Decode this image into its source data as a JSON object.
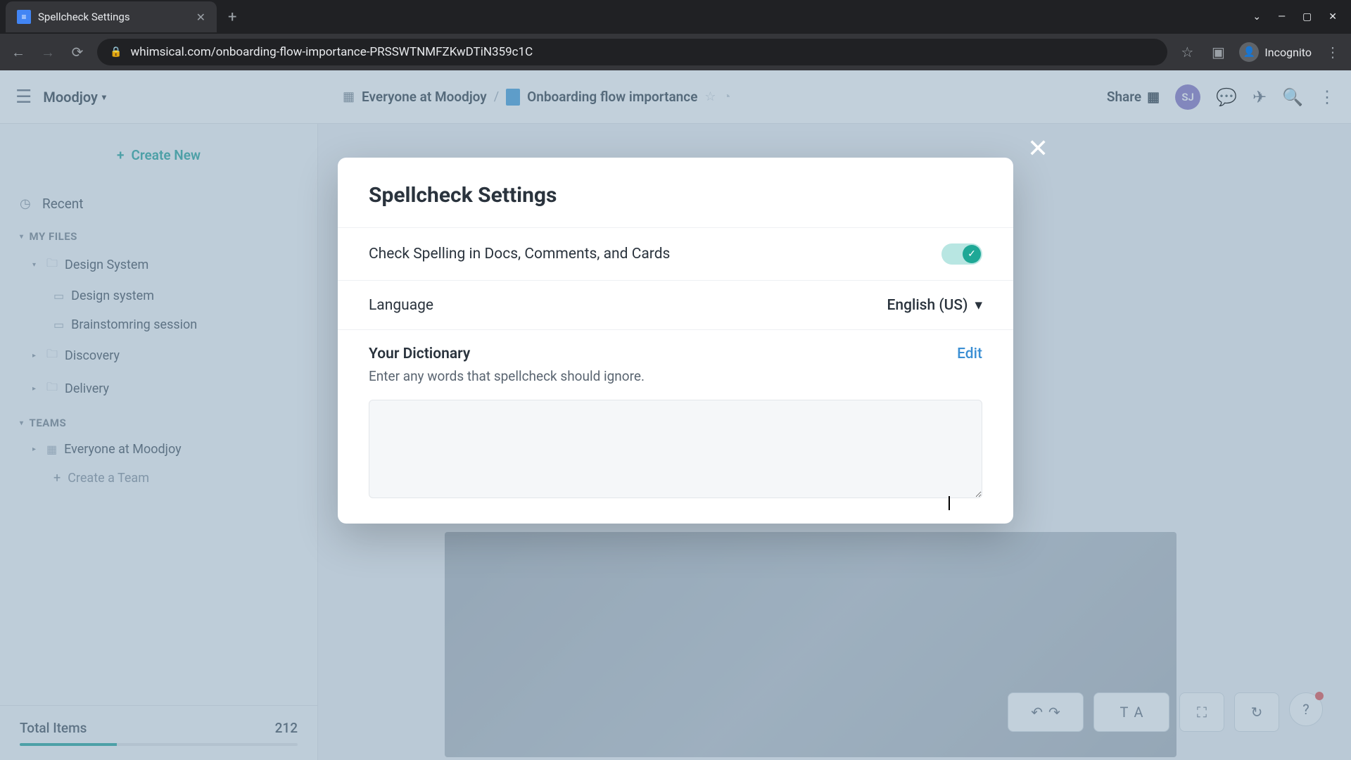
{
  "browser": {
    "tab_title": "Spellcheck Settings",
    "url": "whimsical.com/onboarding-flow-importance-PRSSWTNMFZKwDTiN359c1C",
    "incognito_label": "Incognito"
  },
  "topbar": {
    "workspace": "Moodjoy",
    "breadcrumb_root": "Everyone at Moodjoy",
    "breadcrumb_doc": "Onboarding flow importance",
    "share": "Share",
    "avatar_initials": "SJ"
  },
  "sidebar": {
    "create_new": "Create New",
    "recent": "Recent",
    "my_files_label": "MY FILES",
    "teams_label": "TEAMS",
    "create_team": "Create a Team",
    "total_label": "Total Items",
    "total_value": "212",
    "items": {
      "design_system_folder": "Design System",
      "design_system_file": "Design system",
      "brainstorming": "Brainstomring session",
      "discovery": "Discovery",
      "delivery": "Delivery",
      "everyone": "Everyone at Moodjoy"
    }
  },
  "modal": {
    "title": "Spellcheck Settings",
    "check_spelling_label": "Check Spelling in Docs, Comments, and Cards",
    "language_label": "Language",
    "language_value": "English (US)",
    "dictionary_title": "Your Dictionary",
    "edit_label": "Edit",
    "dictionary_sub": "Enter any words that spellcheck should ignore."
  }
}
